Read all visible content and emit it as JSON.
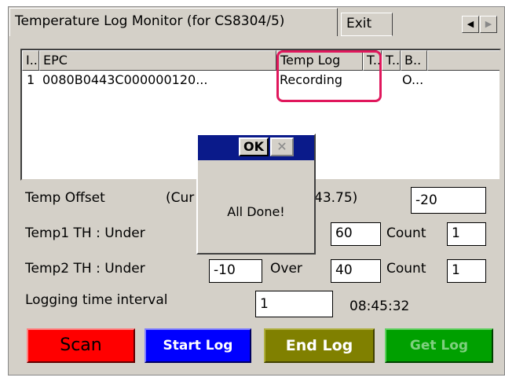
{
  "tabs": {
    "active": "Temperature Log Monitor (for CS8304/5)",
    "exit": "Exit",
    "scroll_left": "◀",
    "scroll_right": "▶"
  },
  "table": {
    "headers": [
      "I..",
      "EPC",
      "Temp Log",
      "T..",
      "T..",
      "B.."
    ],
    "rows": [
      [
        "1",
        "0080B0443C000000120...",
        "Recording",
        "",
        "",
        "O..."
      ]
    ]
  },
  "form": {
    "temp_offset_label": "Temp Offset",
    "current_prefix": "(Cur",
    "current_suffix": "43.75)",
    "temp_offset_value": "-20",
    "temp1_label": "Temp1 TH : Under",
    "temp1_over_value": "60",
    "temp1_count_label": "Count",
    "temp1_count_value": "1",
    "temp2_label": "Temp2 TH : Under",
    "temp2_under_value": "-10",
    "temp2_over_label": "Over",
    "temp2_over_value": "40",
    "temp2_count_label": "Count",
    "temp2_count_value": "1",
    "interval_label": "Logging time interval",
    "interval_value": "1",
    "clock": "08:45:32"
  },
  "buttons": {
    "scan": "Scan",
    "start_log": "Start Log",
    "end_log": "End Log",
    "get_log": "Get Log"
  },
  "dialog": {
    "ok": "OK",
    "close": "✕",
    "message": "All Done!"
  },
  "colors": {
    "scan_bg": "#ff0000",
    "start_bg": "#0000ff",
    "end_bg": "#808000",
    "get_bg": "#00a000",
    "highlight": "#e0175c",
    "dialog_title": "#0a1a8a"
  }
}
